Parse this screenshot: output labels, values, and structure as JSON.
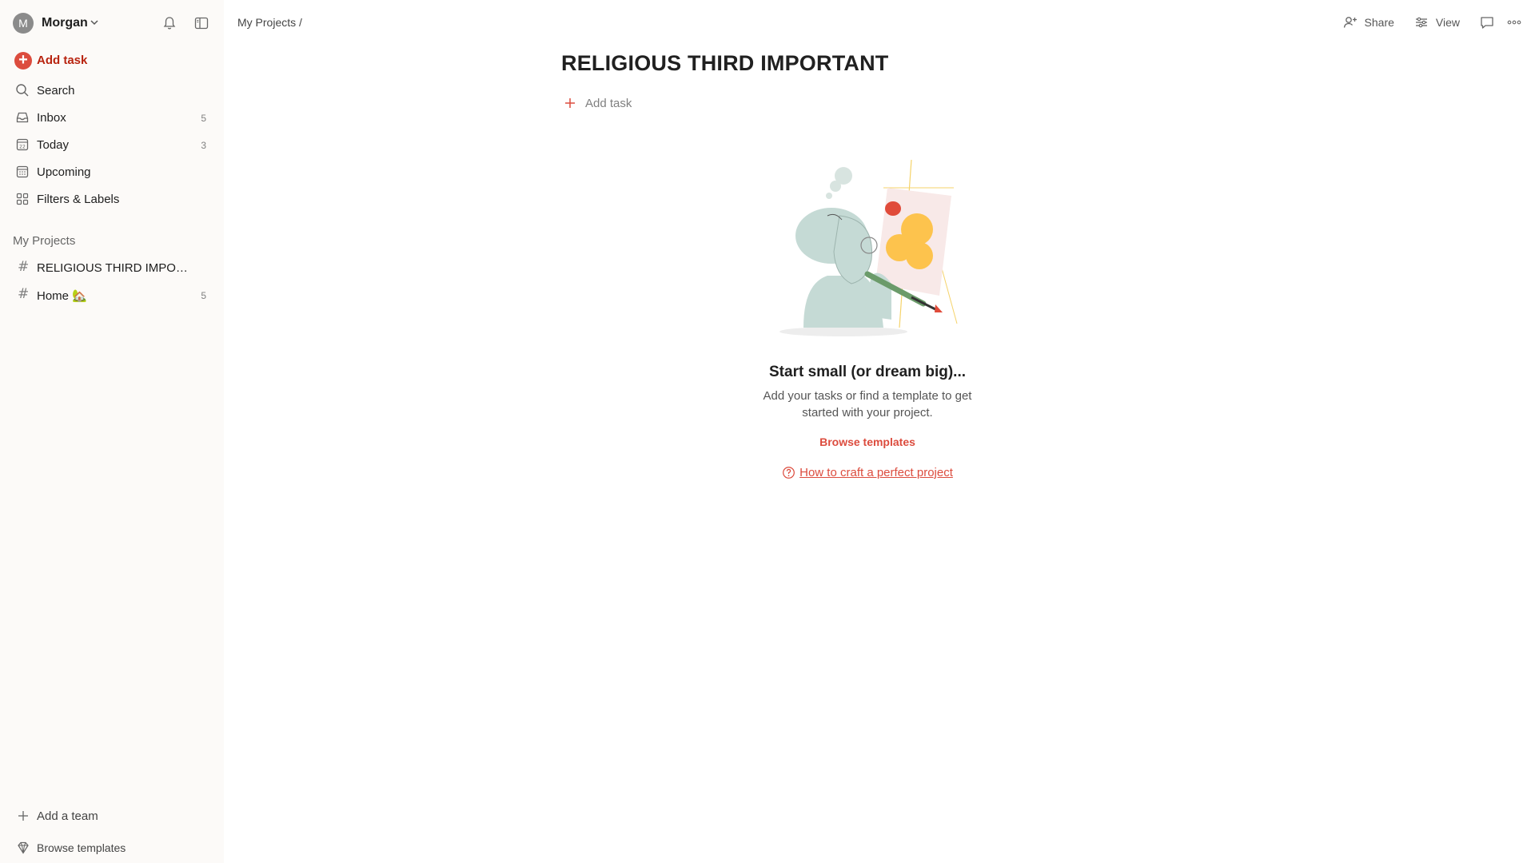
{
  "user": {
    "initial": "M",
    "name": "Morgan"
  },
  "nav": {
    "add_task": "Add task",
    "items": [
      {
        "label": "Search",
        "count": ""
      },
      {
        "label": "Inbox",
        "count": "5"
      },
      {
        "label": "Today",
        "count": "3"
      },
      {
        "label": "Upcoming",
        "count": ""
      },
      {
        "label": "Filters & Labels",
        "count": ""
      }
    ]
  },
  "projects": {
    "section_title": "My Projects",
    "items": [
      {
        "label": "RELIGIOUS THIRD IMPORTANT",
        "count": ""
      },
      {
        "label": "Home 🏡",
        "count": "5"
      }
    ]
  },
  "footer": {
    "add_team": "Add a team",
    "browse_templates": "Browse templates"
  },
  "header": {
    "breadcrumb": "My Projects /",
    "share": "Share",
    "view": "View"
  },
  "main": {
    "title": "RELIGIOUS THIRD IMPORTANT",
    "add_task": "Add task",
    "empty_title": "Start small (or dream big)...",
    "empty_desc": "Add your tasks or find a template to get started with your project.",
    "browse_templates": "Browse templates",
    "howto_link": "How to craft a perfect project"
  },
  "colors": {
    "accent": "#dc4c3e",
    "accent_dark": "#b8230f",
    "sidebar_bg": "#fcfaf8"
  }
}
